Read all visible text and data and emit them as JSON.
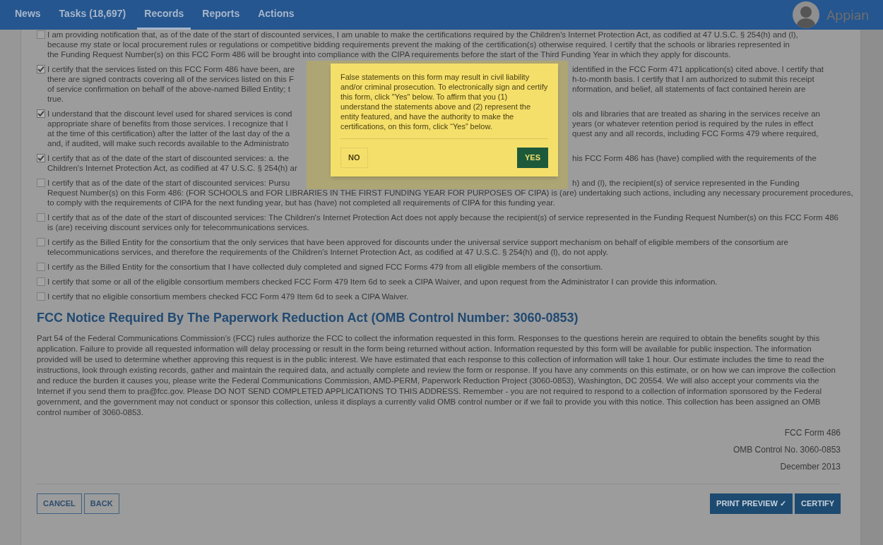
{
  "nav": {
    "tabs": [
      {
        "label": "News",
        "selected": false
      },
      {
        "label": "Tasks (18,697)",
        "selected": false
      },
      {
        "label": "Records",
        "selected": true
      },
      {
        "label": "Reports",
        "selected": false
      },
      {
        "label": "Actions",
        "selected": false
      }
    ],
    "brand": "Appian"
  },
  "certifications": [
    {
      "checked": false,
      "lines": [
        [
          "I am providing notification that, as of the date of the start of discounted services, I am unable to make the certifications required by the Children's Internet Protection Act, as codified at 47 U.S.C. § 254(h) and (l),"
        ],
        [
          "because my state or local procurement rules or regulations or competitive bidding requirements prevent the making of the certification(s) otherwise required. I certify that the schools or libraries represented in"
        ],
        [
          "the Funding Request Number(s) on this FCC Form 486 will be brought into compliance with the CIPA requirements before the start of the Third Funding Year in which they apply for discounts."
        ]
      ]
    },
    {
      "checked": true,
      "lines": [
        [
          "I certify that the services listed on this FCC Form 486 have been, are",
          "identified in the FCC Form 471 application(s) cited above. I certify that"
        ],
        [
          "there are signed contracts covering all of the services listed on this F",
          "h-to-month basis. I certify that I am authorized to submit this receipt"
        ],
        [
          "of service confirmation on behalf of the above-named Billed Entity; t",
          "nformation, and belief, all statements of fact contained herein are"
        ],
        [
          "true."
        ]
      ]
    },
    {
      "checked": true,
      "lines": [
        [
          "I understand that the discount level used for shared services is cond",
          "ols and libraries that are treated as sharing in the services receive an"
        ],
        [
          "appropriate share of benefits from those services. I recognize that I",
          "years (or whatever retention period is required by the rules in effect"
        ],
        [
          "at the time of this certification) after the latter of the last day of the a",
          "quest any and all records, including FCC Forms 479 where required,"
        ],
        [
          "and, if audited, will make such records available to the Administrato"
        ]
      ]
    },
    {
      "checked": true,
      "lines": [
        [
          "I certify that as of the date of the start of discounted services: a. the",
          "his FCC Form 486 has (have) complied with the requirements of the"
        ],
        [
          "Children's Internet Protection Act, as codified at 47 U.S.C. § 254(h) ar"
        ]
      ]
    },
    {
      "checked": false,
      "lines": [
        [
          "I certify that as of the date of the start of discounted services: Pursu",
          "h) and (l), the recipient(s) of service represented in the Funding"
        ],
        [
          "Request Number(s) on this Form 486: (FOR SCHOOLS and FOR LIBRARIES IN THE FIRST FUNDING YEAR FOR PURPOSES OF CIPA) is (are) undertaking such actions, including any necessary procurement procedures,"
        ],
        [
          "to comply with the requirements of CIPA for the next funding year, but has (have) not completed all requirements of CIPA for this funding year."
        ]
      ]
    },
    {
      "checked": false,
      "text": "I certify that as of the date of the start of discounted services: The Children's Internet Protection Act does not apply because the recipient(s) of service represented in the Funding Request Number(s) on this FCC Form 486 is (are) receiving discount services only for telecommunications services."
    },
    {
      "checked": false,
      "text": "I certify as the Billed Entity for the consortium that the only services that have been approved for discounts under the universal service support mechanism on behalf of eligible members of the consortium are telecommunications services, and therefore the requirements of the Children's Internet Protection Act, as codified at 47 U.S.C. § 254(h) and (l), do not apply."
    },
    {
      "checked": false,
      "text": "I certify as the Billed Entity for the consortium that I have collected duly completed and signed FCC Forms 479 from all eligible members of the consortium."
    },
    {
      "checked": false,
      "text": "I certify that some or all of the eligible consortium members checked FCC Form 479 Item 6d to seek a CIPA Waiver, and upon request from the Administrator I can provide this information."
    },
    {
      "checked": false,
      "text": "I certify that no eligible consortium members checked FCC Form 479 Item 6d to seek a CIPA Waiver."
    }
  ],
  "notice": {
    "heading": "FCC Notice Required By The Paperwork Reduction Act (OMB Control Number: 3060-0853)",
    "body": "Part 54 of the Federal Communications Commission’s (FCC) rules authorize the FCC to collect the information requested in this form. Responses to the questions herein are required to obtain the benefits sought by this application. Failure to provide all requested information will delay processing or result in the form being returned without action. Information requested by this form will be available for public inspection. The information provided will be used to determine whether approving this request is in the public interest. We have estimated that each response to this collection of information will take 1 hour. Our estimate includes the time to read the instructions, look through existing records, gather and maintain the required data, and actually complete and review the form or response. If you have any comments on this estimate, or on how we can improve the collection and reduce the burden it causes you, please write the Federal Communications Commission, AMD-PERM, Paperwork Reduction Project (3060-0853), Washington, DC 20554. We will also accept your comments via the Internet if you send them to pra@fcc.gov. Please DO NOT SEND COMPLETED APPLICATIONS TO THIS ADDRESS. Remember - you are not required to respond to a collection of information sponsored by the Federal government, and the government may not conduct or sponsor this collection, unless it displays a currently valid OMB control number or if we fail to provide you with this notice. This collection has been assigned an OMB control number of 3060-0853."
  },
  "form_info": [
    "FCC Form 486",
    "OMB Control No. 3060-0853",
    "December 2013"
  ],
  "buttons_left": [
    {
      "label": "CANCEL",
      "kind": "secondary"
    },
    {
      "label": "BACK",
      "kind": "secondary"
    }
  ],
  "buttons_right": [
    {
      "label": "PRINT PREVIEW ✓",
      "kind": "primary"
    },
    {
      "label": "CERTIFY",
      "kind": "primary"
    }
  ],
  "dialog": {
    "message": "False statements on this form may result in civil liability and/or criminal prosecution. To electronically sign and certify this form, click \"Yes\" below. To affirm that you (1) understand the statements above and (2) represent the entity featured, and have the authority to make the certifications, on this form, click “Yes” below.",
    "buttons": [
      {
        "label": "NO",
        "kind": "secondary"
      },
      {
        "label": "YES",
        "kind": "primary"
      }
    ]
  }
}
